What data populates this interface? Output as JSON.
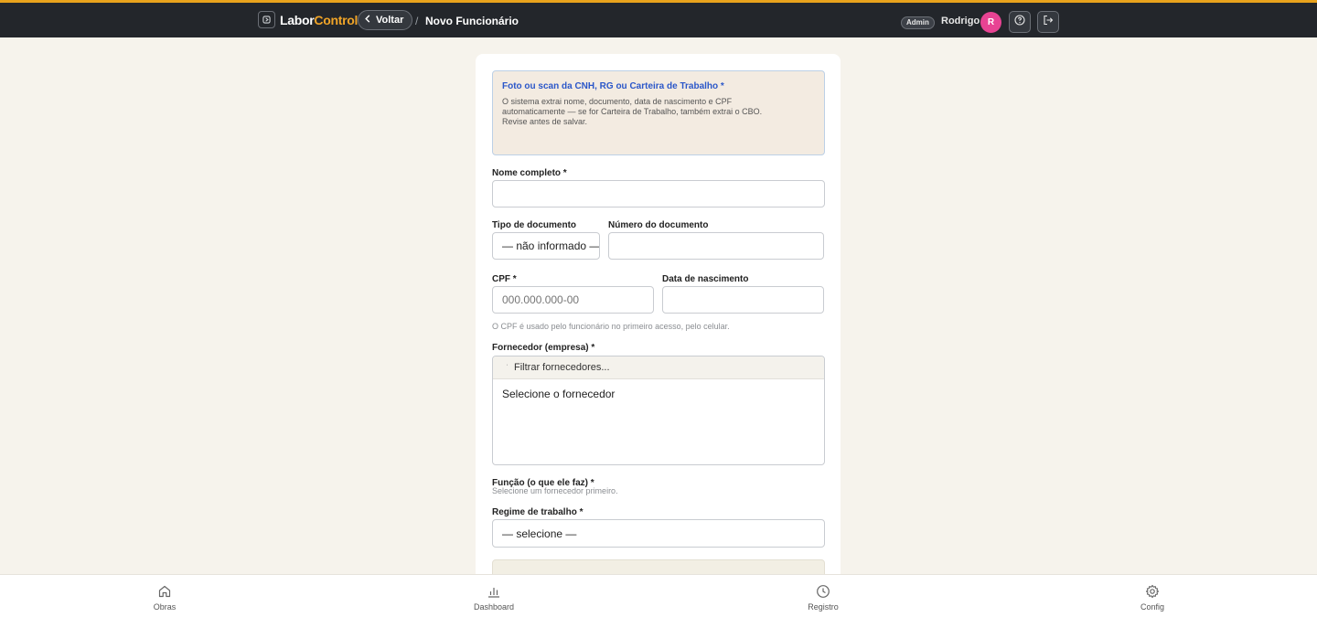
{
  "header": {
    "brand_prefix": "Labor",
    "brand_accent": "Control",
    "back_label": "Voltar",
    "separator": "/",
    "page_title": "Novo Funcionário",
    "role_badge": "Admin",
    "user_name": "Rodrigo",
    "avatar_initial": "R"
  },
  "colors": {
    "accent": "#f0a428",
    "topbar": "#23262b",
    "avatar": "#e84393",
    "info_title": "#2b57c9"
  },
  "form": {
    "info": {
      "title": "Foto ou scan da CNH, RG ou Carteira de Trabalho *",
      "line1": "O sistema extrai nome, documento, data de nascimento e CPF",
      "line2": "automaticamente — se for Carteira de Trabalho, também extrai o CBO.",
      "line3": "Revise antes de salvar."
    },
    "full_name": {
      "label": "Nome completo *",
      "value": ""
    },
    "doc_type": {
      "label": "Tipo de documento",
      "value": "— não informado —"
    },
    "doc_number": {
      "label": "Número do documento",
      "value": ""
    },
    "cpf": {
      "label": "CPF *",
      "placeholder": "000.000.000-00"
    },
    "birth_date": {
      "label": "Data de nascimento",
      "value": ""
    },
    "cpf_hint": "O CPF é usado pelo funcionário no primeiro acesso, pelo celular.",
    "supplier": {
      "label": "Fornecedor (empresa) *",
      "filter_placeholder": "Filtrar fornecedores...",
      "option": "Selecione o fornecedor"
    },
    "role": {
      "label": "Função (o que ele faz) *",
      "hint": "Selecione um fornecedor primeiro."
    },
    "regime": {
      "label": "Regime de trabalho *",
      "value": "— selecione —"
    }
  },
  "bottom_nav": [
    {
      "label": "Obras",
      "icon": "home-icon"
    },
    {
      "label": "Dashboard",
      "icon": "bar-chart-icon"
    },
    {
      "label": "Registro",
      "icon": "clock-icon"
    },
    {
      "label": "Config",
      "icon": "gear-icon"
    }
  ]
}
